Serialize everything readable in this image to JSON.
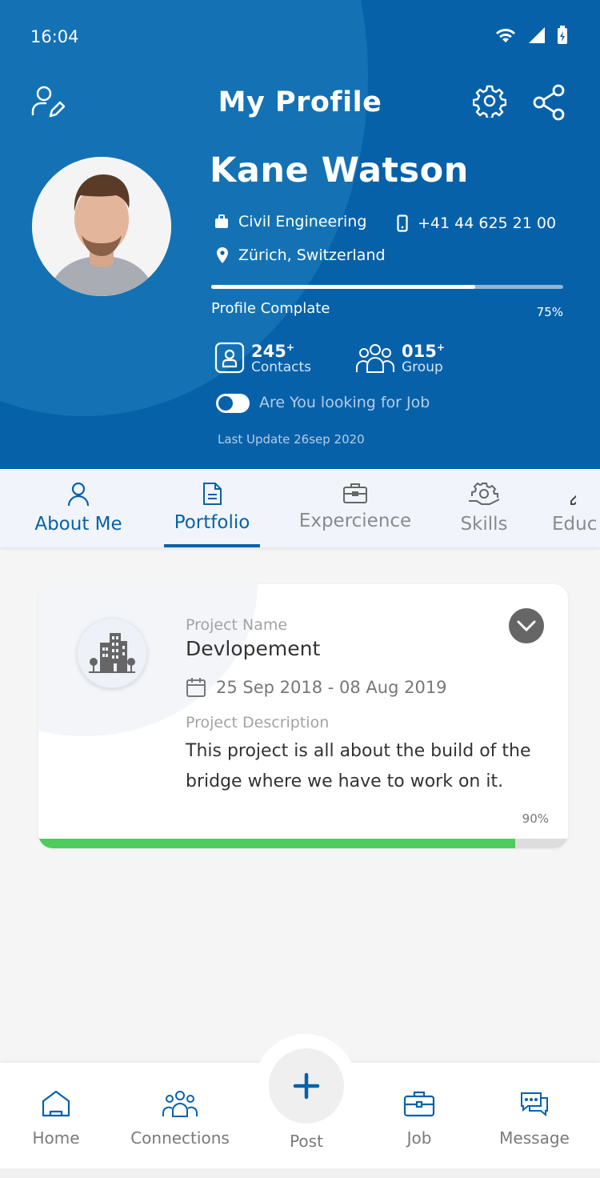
{
  "status": {
    "time": "16:04"
  },
  "header": {
    "title": "My Profile"
  },
  "profile": {
    "name": "Kane Watson",
    "profession": "Civil Engineering",
    "phone": "+41 44 625 21 00",
    "location": "Zürich, Switzerland",
    "progress_label": "Profile Complate",
    "progress_pct": "75%",
    "progress_value": 0.75,
    "contacts_count": "245",
    "contacts_sup": "+",
    "contacts_label": "Contacts",
    "group_count": "015",
    "group_sup": "+",
    "group_label": "Group",
    "job_toggle_label": "Are You looking for Job",
    "last_update": "Last Update 26sep 2020"
  },
  "tabs": [
    {
      "label": "About Me",
      "icon": "user-icon"
    },
    {
      "label": "Portfolio",
      "icon": "document-icon"
    },
    {
      "label": "Expercience",
      "icon": "briefcase-icon"
    },
    {
      "label": "Skills",
      "icon": "gear-hand-icon"
    },
    {
      "label": "Educ",
      "icon": "pen-icon"
    }
  ],
  "project": {
    "name_label": "Project Name",
    "name": "Devlopement",
    "date": "25 Sep 2018 - 08 Aug 2019",
    "desc_label": "Project Description",
    "description": "This project is all about the build of the bridge where we have to work on it.",
    "pct": "90%",
    "progress_value": 0.9
  },
  "bottom_nav": [
    {
      "label": "Home",
      "icon": "home-icon"
    },
    {
      "label": "Connections",
      "icon": "connections-icon"
    },
    {
      "label": "Post",
      "icon": "plus-icon"
    },
    {
      "label": "Job",
      "icon": "briefcase-icon"
    },
    {
      "label": "Message",
      "icon": "chat-icon"
    }
  ],
  "colors": {
    "primary": "#0761a9",
    "progress_green": "#4ecb5f",
    "text_gray": "#7a7a7a"
  }
}
